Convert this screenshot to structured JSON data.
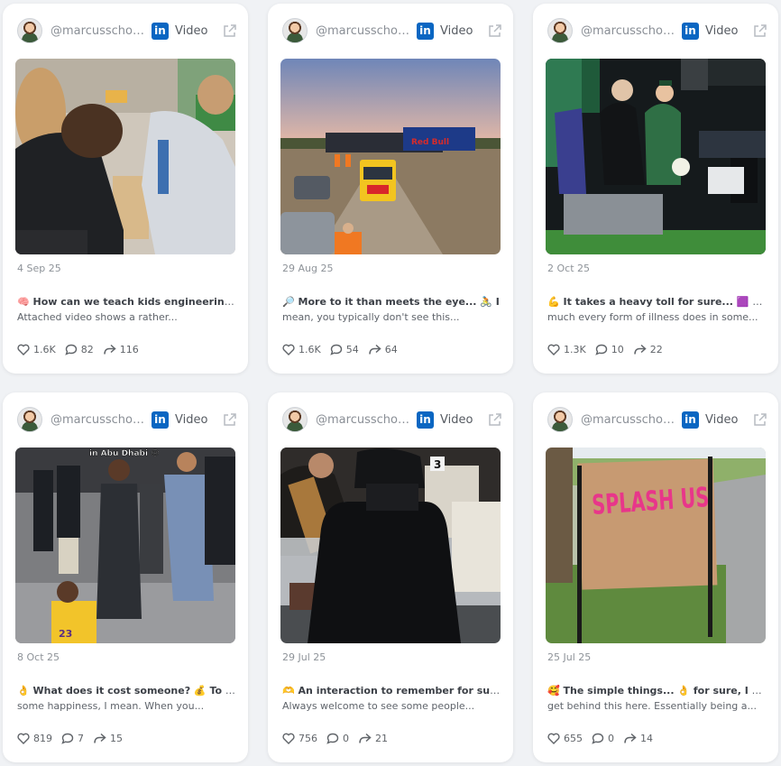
{
  "cards": [
    {
      "handle": "@marcusschol...",
      "platform": "in",
      "type_label": "Video",
      "date": "4 Sep 25",
      "caption_title": "🧠 How can we teach kids engineering? 📽",
      "caption_body": "Attached video shows a rather...",
      "likes": "1.6K",
      "comments": "82",
      "shares": "116"
    },
    {
      "handle": "@marcusschol...",
      "platform": "in",
      "type_label": "Video",
      "date": "29 Aug 25",
      "caption_title": "🔎 More to it than meets the eye... 🚴 I",
      "caption_body": "mean, you typically don't see this...",
      "likes": "1.6K",
      "comments": "54",
      "shares": "64"
    },
    {
      "handle": "@marcusschol...",
      "platform": "in",
      "type_label": "Video",
      "date": "2 Oct 25",
      "caption_title": "💪 It takes a heavy toll for sure... 🟪 pretty",
      "caption_body": "much every form of illness does in some...",
      "likes": "1.3K",
      "comments": "10",
      "shares": "22"
    },
    {
      "handle": "@marcusschol...",
      "platform": "in",
      "type_label": "Video",
      "date": "8 Oct 25",
      "caption_title": "👌 What does it cost someone? 💰 To share",
      "caption_body": "some happiness, I mean. When you...",
      "likes": "819",
      "comments": "7",
      "shares": "15"
    },
    {
      "handle": "@marcusschol...",
      "platform": "in",
      "type_label": "Video",
      "date": "29 Jul 25",
      "caption_title": "🫶 An interaction to remember for sure 👌",
      "caption_body": "Always welcome to see some people...",
      "likes": "756",
      "comments": "0",
      "shares": "21"
    },
    {
      "handle": "@marcusschol...",
      "platform": "in",
      "type_label": "Video",
      "date": "25 Jul 25",
      "caption_title": "🥰 The simple things... 👌 for sure, I can",
      "caption_body": "get behind this here. Essentially being a...",
      "likes": "655",
      "comments": "0",
      "shares": "14"
    }
  ],
  "thumb_overlays": {
    "card_1_banner": "Red Bull",
    "card_3_text": "in Abu Dhabi 😢",
    "card_4_number": "3",
    "card_5_sign": "SPLASH US"
  },
  "colors": {
    "linkedin": "#0a66c2",
    "page_bg": "#f0f2f5"
  }
}
